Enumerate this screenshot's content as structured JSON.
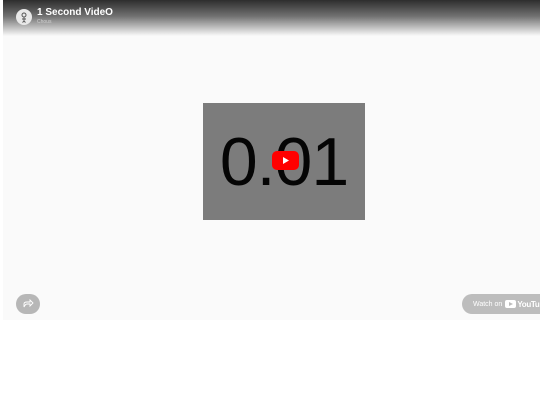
{
  "video": {
    "title": "1 Second VideO",
    "channel": "Chous",
    "thumbnail_text": "0.01"
  },
  "controls": {
    "play_icon": "play-icon",
    "share_icon": "share-icon",
    "watch_on_label": "Watch on",
    "youtube_wordmark": "YouTube"
  },
  "colors": {
    "play_button": "#ff0000",
    "thumbnail_bg": "#7c7c7c",
    "player_bg": "#fafafa",
    "pill_bg": "#bdbdbd"
  }
}
